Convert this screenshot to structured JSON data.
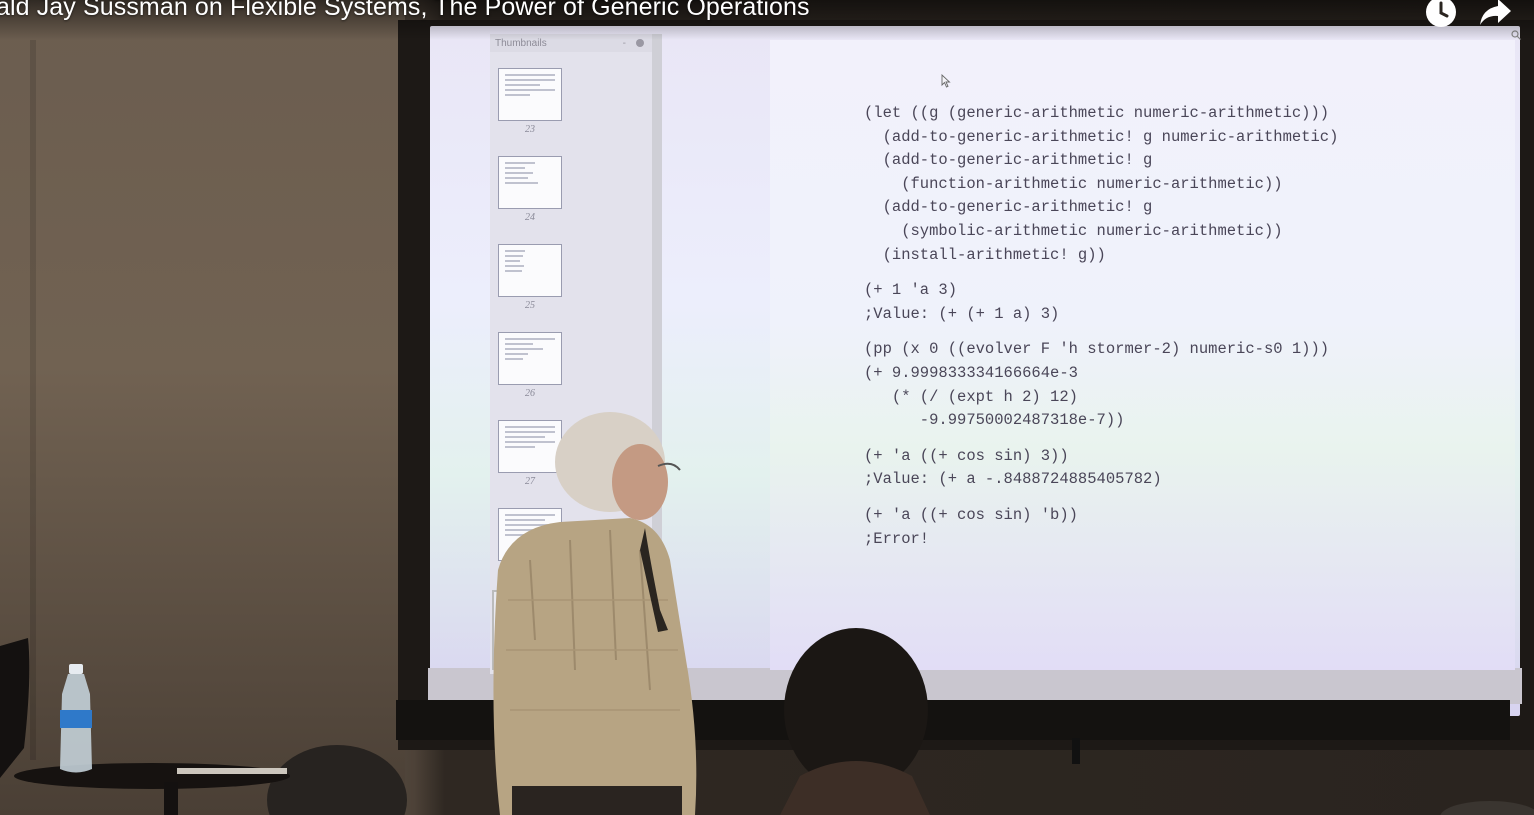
{
  "video": {
    "title": "ald Jay Sussman on Flexible Systems, The Power of Generic Operations",
    "controls": {
      "watch_later_icon": "clock-icon",
      "share_icon": "share-arrow-icon"
    }
  },
  "pdf_viewer": {
    "sidebar_title": "Thumbnails",
    "thumbnails": [
      {
        "page": "23"
      },
      {
        "page": "24"
      },
      {
        "page": "25"
      },
      {
        "page": "26"
      },
      {
        "page": "27"
      },
      {
        "page": ""
      }
    ]
  },
  "slide": {
    "code_lines": [
      "(let ((g (generic-arithmetic numeric-arithmetic)))",
      "  (add-to-generic-arithmetic! g numeric-arithmetic)",
      "  (add-to-generic-arithmetic! g",
      "    (function-arithmetic numeric-arithmetic))",
      "  (add-to-generic-arithmetic! g",
      "    (symbolic-arithmetic numeric-arithmetic))",
      "  (install-arithmetic! g))",
      "",
      "(+ 1 'a 3)",
      ";Value: (+ (+ 1 a) 3)",
      "",
      "(pp (x 0 ((evolver F 'h stormer-2) numeric-s0 1)))",
      "(+ 9.999833334166664e-3",
      "   (* (/ (expt h 2) 12)",
      "      -9.99750002487318e-7))",
      "",
      "(+ 'a ((+ cos sin) 3))",
      ";Value: (+ a -.8488724885405782)",
      "",
      "(+ 'a ((+ cos sin) 'b))",
      ";Error!"
    ]
  },
  "colors": {
    "title_text": "#ffffff",
    "code_text": "#4a4658",
    "slide_background": "#eef0fb"
  }
}
